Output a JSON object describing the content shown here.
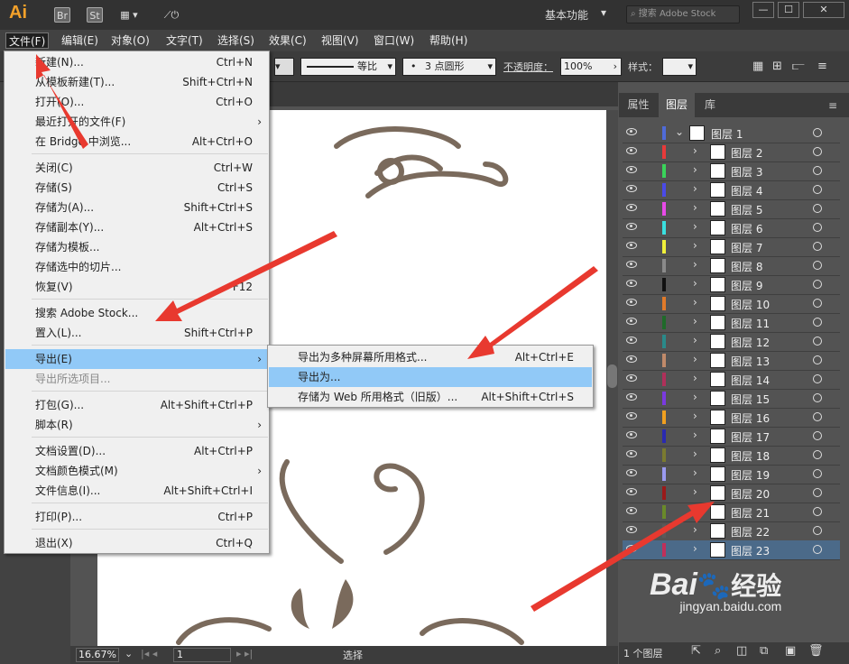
{
  "app": {
    "logo": "Ai",
    "bridge_label": "Br",
    "stock_label": "St",
    "workspace": "基本功能",
    "search_placeholder": "搜索 Adobe Stock"
  },
  "menubar": [
    {
      "label": "文件(F)"
    },
    {
      "label": "编辑(E)"
    },
    {
      "label": "对象(O)"
    },
    {
      "label": "文字(T)"
    },
    {
      "label": "选择(S)"
    },
    {
      "label": "效果(C)"
    },
    {
      "label": "视图(V)"
    },
    {
      "label": "窗口(W)"
    },
    {
      "label": "帮助(H)"
    }
  ],
  "control": {
    "stroke_label": "等比",
    "brush_label": "3 点圆形",
    "opacity_label": "不透明度：",
    "opacity_value": "100%",
    "style_label": "样式："
  },
  "file_menu": [
    {
      "label": "新建(N)...",
      "shortcut": "Ctrl+N"
    },
    {
      "label": "从模板新建(T)...",
      "shortcut": "Shift+Ctrl+N"
    },
    {
      "label": "打开(O)...",
      "shortcut": "Ctrl+O"
    },
    {
      "label": "最近打开的文件(F)",
      "shortcut": ""
    },
    {
      "label": "在 Bridge 中浏览...",
      "shortcut": "Alt+Ctrl+O"
    },
    {
      "label": "关闭(C)",
      "shortcut": "Ctrl+W"
    },
    {
      "label": "存储(S)",
      "shortcut": "Ctrl+S"
    },
    {
      "label": "存储为(A)...",
      "shortcut": "Shift+Ctrl+S"
    },
    {
      "label": "存储副本(Y)...",
      "shortcut": "Alt+Ctrl+S"
    },
    {
      "label": "存储为模板...",
      "shortcut": ""
    },
    {
      "label": "存储选中的切片...",
      "shortcut": ""
    },
    {
      "label": "恢复(V)",
      "shortcut": "F12"
    },
    {
      "label": "搜索 Adobe Stock...",
      "shortcut": ""
    },
    {
      "label": "置入(L)...",
      "shortcut": "Shift+Ctrl+P"
    },
    {
      "label": "导出(E)",
      "shortcut": ""
    },
    {
      "label": "导出所选项目...",
      "shortcut": ""
    },
    {
      "label": "打包(G)...",
      "shortcut": "Alt+Shift+Ctrl+P"
    },
    {
      "label": "脚本(R)",
      "shortcut": ""
    },
    {
      "label": "文档设置(D)...",
      "shortcut": "Alt+Ctrl+P"
    },
    {
      "label": "文档颜色模式(M)",
      "shortcut": ""
    },
    {
      "label": "文件信息(I)...",
      "shortcut": "Alt+Shift+Ctrl+I"
    },
    {
      "label": "打印(P)...",
      "shortcut": "Ctrl+P"
    },
    {
      "label": "退出(X)",
      "shortcut": "Ctrl+Q"
    }
  ],
  "export_submenu": [
    {
      "label": "导出为多种屏幕所用格式...",
      "shortcut": "Alt+Ctrl+E"
    },
    {
      "label": "导出为...",
      "shortcut": ""
    },
    {
      "label": "存储为 Web 所用格式（旧版）...",
      "shortcut": "Alt+Shift+Ctrl+S"
    }
  ],
  "panel": {
    "tabs": [
      "属性",
      "图层",
      "库"
    ],
    "active_tab": "图层",
    "layer_count": "1 个图层",
    "layers": [
      {
        "name": "图层 1",
        "color": "#4f6bd8"
      },
      {
        "name": "图层 2",
        "color": "#e83a3a"
      },
      {
        "name": "图层 3",
        "color": "#3ad45a"
      },
      {
        "name": "图层 4",
        "color": "#4a4ae8"
      },
      {
        "name": "图层 5",
        "color": "#e84ae8"
      },
      {
        "name": "图层 6",
        "color": "#3ae0e0"
      },
      {
        "name": "图层 7",
        "color": "#f0f03a"
      },
      {
        "name": "图层 8",
        "color": "#8a8a8a"
      },
      {
        "name": "图层 9",
        "color": "#111111"
      },
      {
        "name": "图层 10",
        "color": "#e07a2a"
      },
      {
        "name": "图层 11",
        "color": "#1f6a2a"
      },
      {
        "name": "图层 12",
        "color": "#2a8a8a"
      },
      {
        "name": "图层 13",
        "color": "#c08a6a"
      },
      {
        "name": "图层 14",
        "color": "#b0305a"
      },
      {
        "name": "图层 15",
        "color": "#7a3ae0"
      },
      {
        "name": "图层 16",
        "color": "#f0a020"
      },
      {
        "name": "图层 17",
        "color": "#2a2ab0"
      },
      {
        "name": "图层 18",
        "color": "#7a7a30"
      },
      {
        "name": "图层 19",
        "color": "#9a9af0"
      },
      {
        "name": "图层 20",
        "color": "#9a1a1a"
      },
      {
        "name": "图层 21",
        "color": "#6a8a2a"
      },
      {
        "name": "图层 22",
        "color": "#5a5a5a"
      },
      {
        "name": "图层 23",
        "color": "#c0305a"
      }
    ]
  },
  "status": {
    "zoom": "16.67%",
    "page": "1",
    "tool": "选择"
  },
  "watermark": {
    "brand": "Bai",
    "brand2": "经验",
    "url": "jingyan.baidu.com"
  },
  "colors": {
    "highlight": "#91c9f7",
    "arrow": "#e8392f",
    "ornament": "#7a6a5c"
  }
}
